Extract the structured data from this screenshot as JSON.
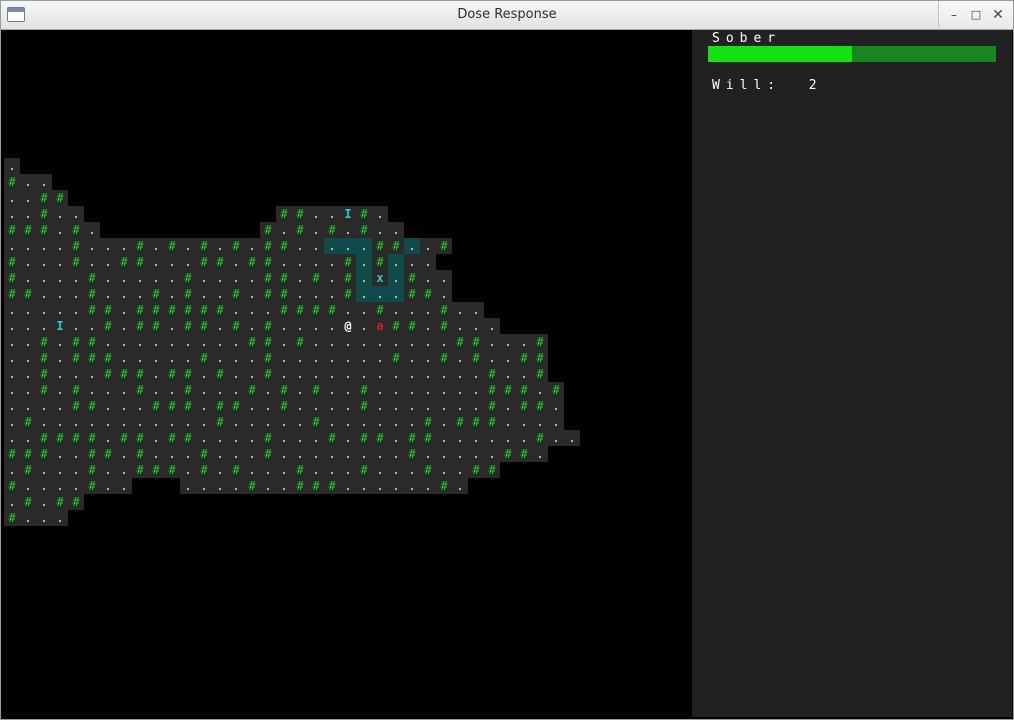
{
  "window": {
    "title": "Dose Response"
  },
  "sidebar": {
    "sober_label": "Sober",
    "sober_level": 0.5,
    "will_label": "Will:",
    "will_value": "2"
  },
  "colors": {
    "floor_tile": "#2a2a2a",
    "seen_floor": "#2a2a2a",
    "highlight": "#0e4a4a",
    "wall": "#21d321",
    "dot": "#e6e6e6",
    "item": "#2ec8c8",
    "monster": "#cc2222",
    "player": "#ffffff"
  },
  "legend": {
    "wall": "#",
    "floor": ".",
    "player": "@",
    "monster": "a",
    "item": "I",
    "marker": "x"
  },
  "map": {
    "rows": [
      {
        "row": 4,
        "start": 0,
        "cells": "."
      },
      {
        "row": 5,
        "start": 0,
        "cells": "#.."
      },
      {
        "row": 6,
        "start": 0,
        "cells": "..##"
      },
      {
        "row": 7,
        "start": 0,
        "cells": "..#..",
        "extra": [
          {
            "start": 17,
            "cells": "##..I#."
          }
        ]
      },
      {
        "row": 8,
        "start": 0,
        "cells": "###.#.",
        "extra": [
          {
            "start": 16,
            "cells": "#.#.#.#.."
          }
        ]
      },
      {
        "row": 9,
        "start": 0,
        "cells": "....#...#.#.#.#.##..~~~##~.#"
      },
      {
        "row": 10,
        "start": 0,
        "cells": "#...#..##...##.##....#~#~.."
      },
      {
        "row": 11,
        "start": 0,
        "cells": "#....#.....#....##.#.#~x~#.."
      },
      {
        "row": 12,
        "start": 0,
        "cells": "##...#...#.#..#.##...#~~~##."
      },
      {
        "row": 13,
        "start": 0,
        "cells": ".....##.######...####..#...#.."
      },
      {
        "row": 14,
        "start": 0,
        "cells": "...I..#.##.##.#.#....@.a##.#..."
      },
      {
        "row": 15,
        "start": 0,
        "cells": "..#.##.........##.#.........##...#"
      },
      {
        "row": 16,
        "start": 0,
        "cells": "..#.###.....#...#.......#..#.#..##"
      },
      {
        "row": 17,
        "start": 0,
        "cells": "..#...###.##.#..#.............#..#"
      },
      {
        "row": 18,
        "start": 0,
        "cells": "..#.#...#..#...#.#.#..#.......###.#"
      },
      {
        "row": 19,
        "start": 0,
        "cells": "....##...###.##..#....#.......#.##."
      },
      {
        "row": 20,
        "start": 0,
        "cells": ".#...........#.....#......#.###...."
      },
      {
        "row": 21,
        "start": 0,
        "cells": "..####.##.##....#...#.##.##......#.."
      },
      {
        "row": 22,
        "start": 0,
        "cells": "###..##.#...#...#........#.....##."
      },
      {
        "row": 23,
        "start": 0,
        "cells": ".#...#..###.#.#...#...#...#..##"
      },
      {
        "row": 24,
        "start": 0,
        "cells": "#....#..",
        "extra": [
          {
            "start": 11,
            "cells": "....#..###......#."
          }
        ]
      },
      {
        "row": 25,
        "start": 0,
        "cells": ".#.##"
      },
      {
        "row": 26,
        "start": 0,
        "cells": "#..."
      }
    ]
  }
}
